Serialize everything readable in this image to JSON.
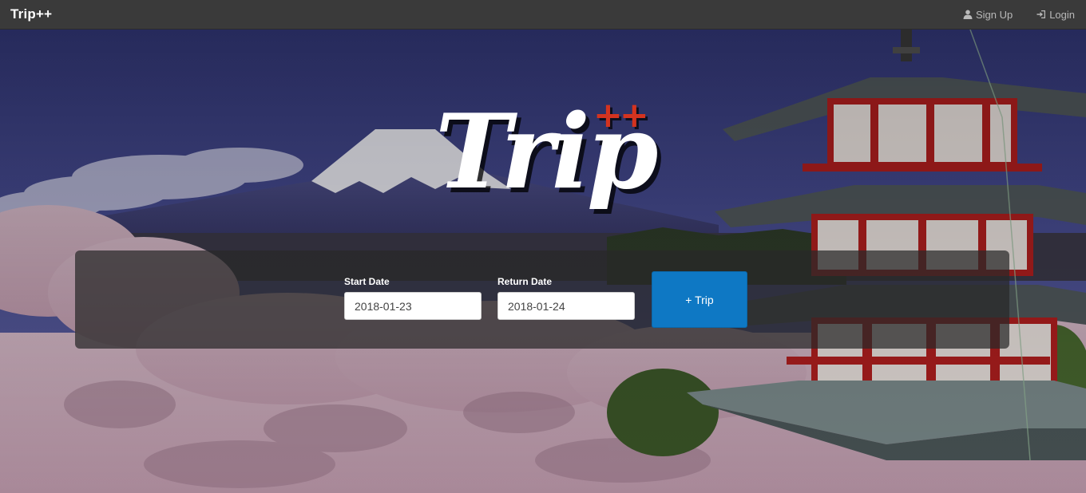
{
  "navbar": {
    "brand": "Trip++",
    "signup_label": "Sign Up",
    "login_label": "Login",
    "signup_icon": "user-icon",
    "login_icon": "login-icon"
  },
  "hero": {
    "logo_text": "Trip",
    "logo_suffix": "++"
  },
  "search": {
    "start_label": "Start Date",
    "start_value": "2018-01-23",
    "return_label": "Return Date",
    "return_value": "2018-01-24",
    "submit_label": "+ Trip"
  },
  "colors": {
    "navbar_bg": "#3a3a3a",
    "accent_blue": "#0e78c4",
    "logo_red": "#d4331f"
  }
}
